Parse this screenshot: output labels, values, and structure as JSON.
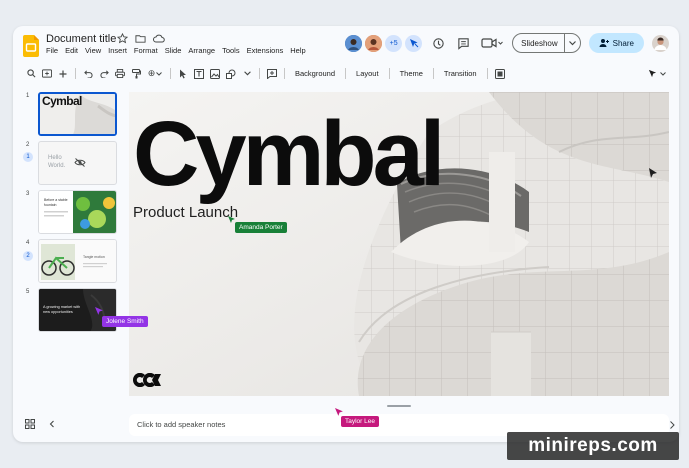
{
  "header": {
    "doc_title": "Document title",
    "menu": [
      "File",
      "Edit",
      "View",
      "Insert",
      "Format",
      "Slide",
      "Arrange",
      "Tools",
      "Extensions",
      "Help"
    ],
    "collaborator_count": "+5",
    "slideshow_label": "Slideshow",
    "share_label": "Share"
  },
  "toolbar": {
    "zoom_symbol": "⊕",
    "background_label": "Background",
    "layout_label": "Layout",
    "theme_label": "Theme",
    "transition_label": "Transition"
  },
  "filmstrip": {
    "slides": [
      {
        "number": "1",
        "title": "Cymbal"
      },
      {
        "number": "2",
        "badge": "1",
        "title": "Hello World."
      },
      {
        "number": "3",
        "title": "Before a stable fountain"
      },
      {
        "number": "4",
        "badge": "2",
        "title": "Tangle motion"
      },
      {
        "number": "5",
        "title": "A growing market with new opportunities"
      }
    ]
  },
  "canvas": {
    "title": "Cymbal",
    "subtitle": "Product Launch"
  },
  "cursors": [
    {
      "name": "Amanda Porter",
      "color": "#188038"
    },
    {
      "name": "Jolene Smith",
      "color": "#9334e6"
    },
    {
      "name": "Taylor Lee",
      "color": "#c5197d"
    }
  ],
  "notes": {
    "placeholder": "Click to add speaker notes"
  },
  "watermark": "minireps.com",
  "colors": {
    "accent": "#0b57d0",
    "share_bg": "#c2e7ff",
    "logo_yellow": "#fbbc04"
  }
}
